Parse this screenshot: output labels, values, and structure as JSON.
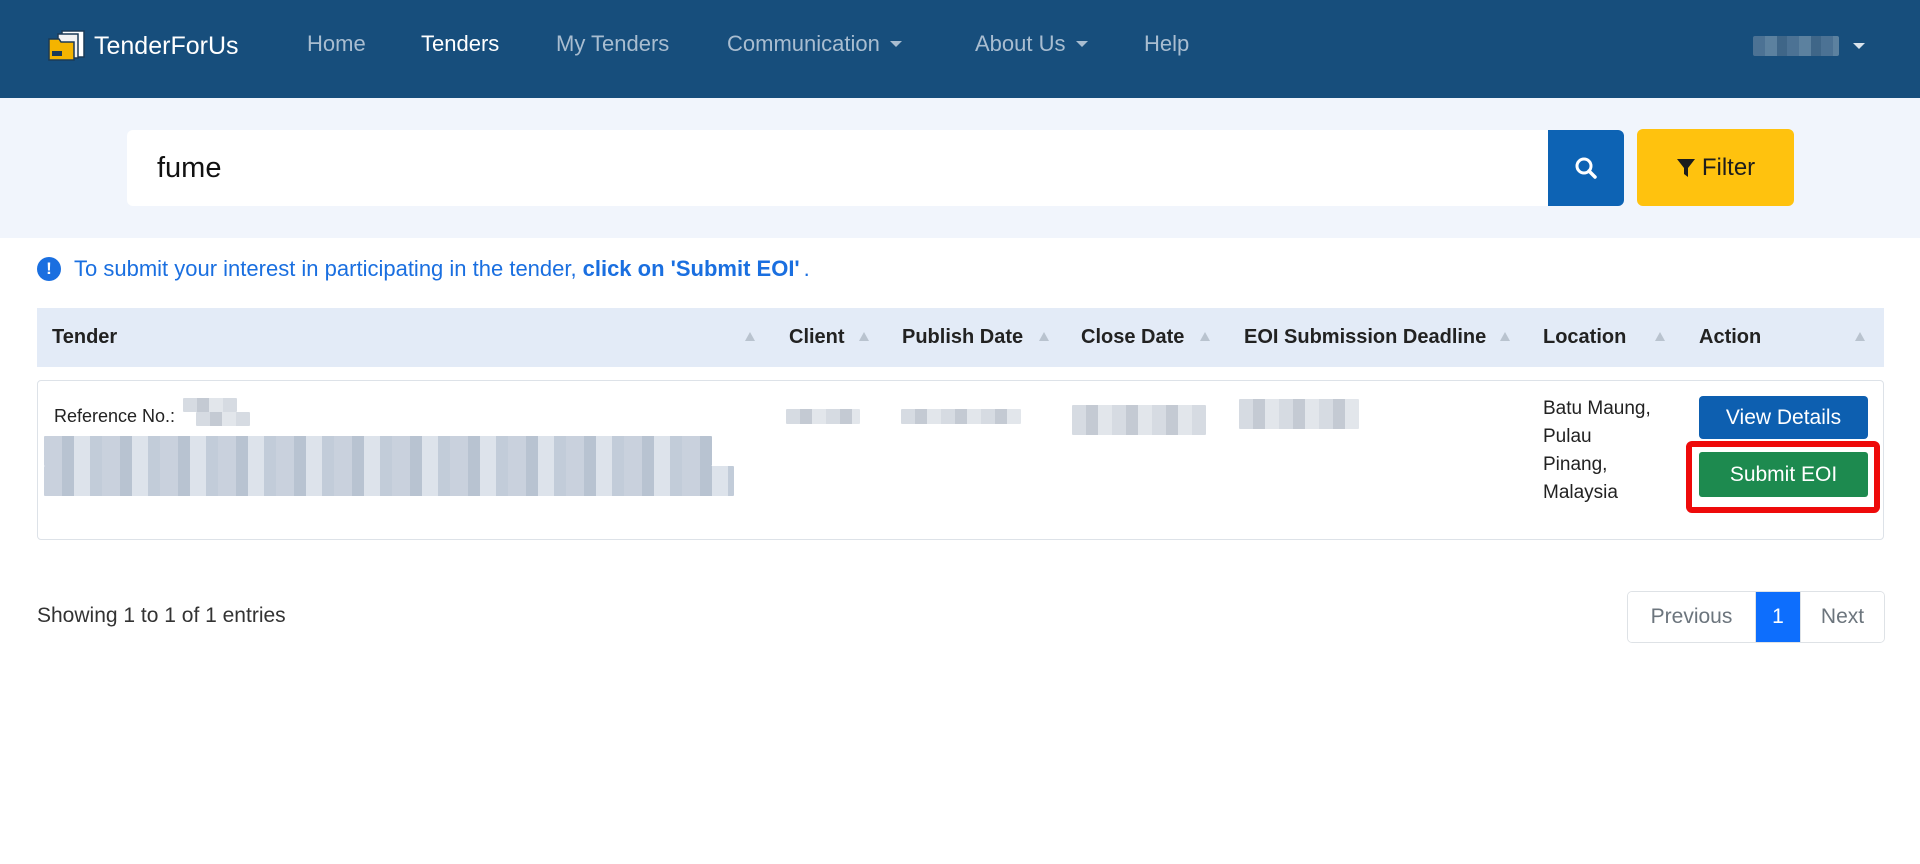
{
  "navbar": {
    "brand": "TenderForUs",
    "links": [
      {
        "label": "Home"
      },
      {
        "label": "Tenders"
      },
      {
        "label": "My Tenders"
      },
      {
        "label": "Communication"
      },
      {
        "label": "About Us"
      },
      {
        "label": "Help"
      }
    ],
    "active": "Tenders"
  },
  "search": {
    "value": "fume",
    "filter_label": "Filter"
  },
  "info": {
    "text": "To submit your interest in participating in the tender,",
    "bold": "click on 'Submit EOI'",
    "tail": "."
  },
  "table": {
    "columns": [
      "Tender",
      "Client",
      "Publish Date",
      "Close Date",
      "EOI Submission Deadline",
      "Location",
      "Action"
    ],
    "rows": [
      {
        "reference_label": "Reference No.:",
        "location_lines": [
          "Batu Maung,",
          "Pulau",
          "Pinang,",
          "Malaysia"
        ],
        "view_label": "View Details",
        "eoi_label": "Submit EOI"
      }
    ]
  },
  "footer": {
    "showing": "Showing 1 to 1 of 1 entries",
    "pagination": {
      "previous": "Previous",
      "current": "1",
      "next": "Next"
    }
  },
  "colors": {
    "navbar": "#174e7c",
    "search_button": "#0d63b4",
    "filter_button": "#ffc20e",
    "view_button": "#0d5fb0",
    "eoi_button": "#1d8a4f",
    "highlight": "#ee0a0a",
    "pager_active": "#0d6efd"
  }
}
